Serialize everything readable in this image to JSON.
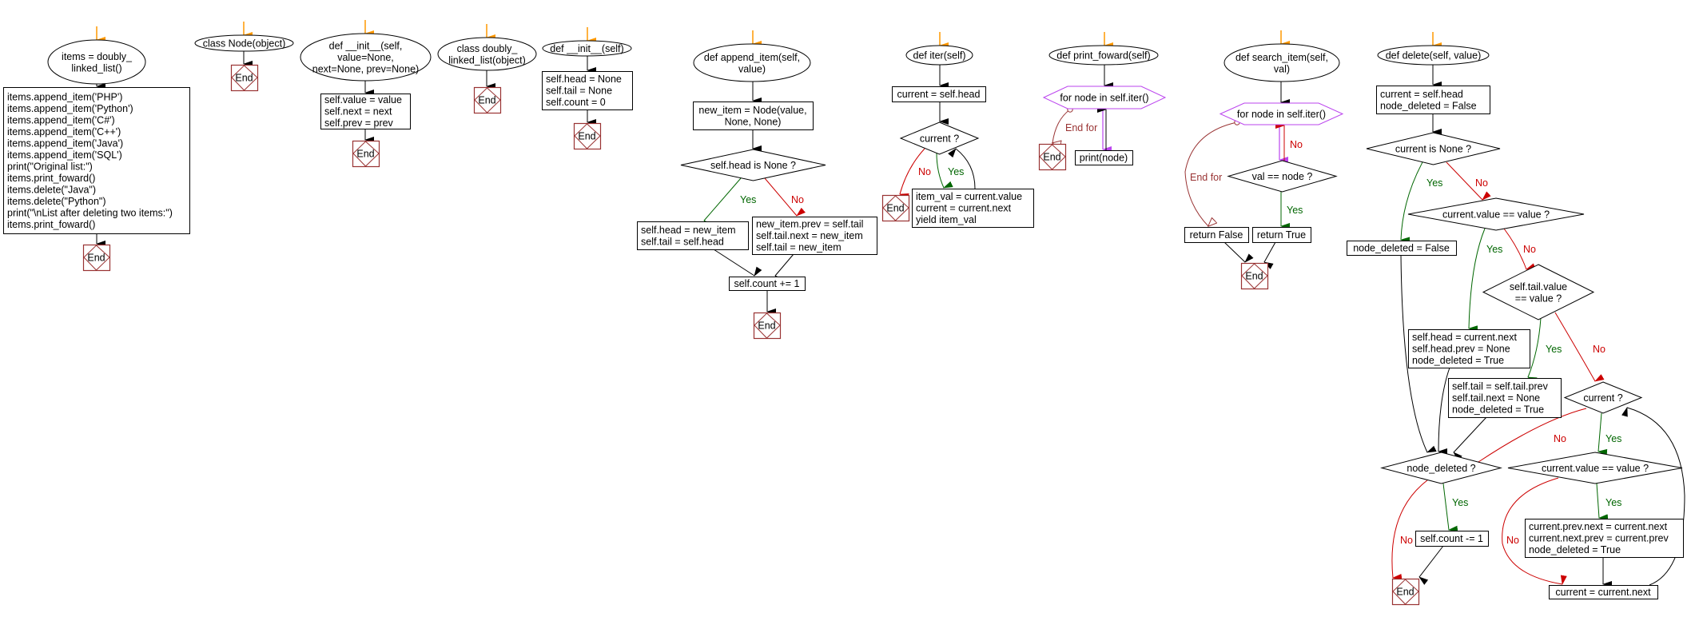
{
  "colors": {
    "start_arrow": "#ff9900",
    "yes": "#006600",
    "no": "#cc0000",
    "end_border": "#993333",
    "loop": "#bb44ee",
    "endfor": "#993333"
  },
  "labels": {
    "yes": "Yes",
    "no": "No",
    "end": "End",
    "end_for": "End for"
  },
  "charts": {
    "main": {
      "start": [
        "items = doubly_",
        "linked_list()"
      ],
      "body": [
        "items.append_item('PHP')",
        "items.append_item('Python')",
        "items.append_item('C#')",
        "items.append_item('C++')",
        "items.append_item('Java')",
        "items.append_item('SQL')",
        "print(\"Original list:\")",
        "items.print_foward()",
        "items.delete(\"Java\")",
        "items.delete(\"Python\")",
        "print(\"\\nList after deleting two items:\")",
        "items.print_foward()"
      ]
    },
    "node_class": {
      "start": [
        "class Node(object)"
      ]
    },
    "node_init": {
      "start": [
        "def __init__(self,",
        "value=None,",
        "next=None, prev=None)"
      ],
      "body": [
        "self.value = value",
        "self.next = next",
        "self.prev = prev"
      ]
    },
    "dll_class": {
      "start": [
        "class doubly_",
        "linked_list(object)"
      ]
    },
    "dll_init": {
      "start": [
        "def __init__(self)"
      ],
      "body": [
        "self.head = None",
        "self.tail = None",
        "self.count = 0"
      ]
    },
    "append_item": {
      "start": [
        "def append_item(self,",
        "value)"
      ],
      "step1": [
        "new_item = Node(value,",
        "None, None)"
      ],
      "cond": "self.head is None ?",
      "yes_body": [
        "self.head = new_item",
        "self.tail = self.head"
      ],
      "no_body": [
        "new_item.prev = self.tail",
        "self.tail.next = new_item",
        "self.tail = new_item"
      ],
      "step2": [
        "self.count += 1"
      ]
    },
    "iter": {
      "start": [
        "def iter(self)"
      ],
      "step1": [
        "current = self.head"
      ],
      "cond": "current ?",
      "yes_body": [
        "item_val = current.value",
        "current = current.next",
        "yield item_val"
      ]
    },
    "print_foward": {
      "start": [
        "def print_foward(self)"
      ],
      "loop": "for node in self.iter()",
      "body": [
        "print(node)"
      ]
    },
    "search_item": {
      "start": [
        "def search_item(self,",
        "val)"
      ],
      "loop": "for node in self.iter()",
      "cond": "val == node ?",
      "endfor_body": [
        "return False"
      ],
      "yes_body": [
        "return True"
      ]
    },
    "delete": {
      "start": [
        "def delete(self, value)"
      ],
      "step1": [
        "current = self.head",
        "node_deleted = False"
      ],
      "cond1": "current is None ?",
      "yes1": [
        "node_deleted = False"
      ],
      "cond2": "current.value == value ?",
      "yes2": [
        "self.head = current.next",
        "self.head.prev = None",
        "node_deleted = True"
      ],
      "cond3": [
        "self.tail.value",
        "== value ?"
      ],
      "yes3": [
        "self.tail = self.tail.prev",
        "self.tail.next = None",
        "node_deleted = True"
      ],
      "cond4": "current ?",
      "cond5": "current.value == value ?",
      "yes5": [
        "current.prev.next = current.next",
        "current.next.prev = current.prev",
        "node_deleted = True"
      ],
      "step_next": [
        "current = current.next"
      ],
      "cond6": "node_deleted ?",
      "yes6": [
        "self.count -= 1"
      ]
    }
  }
}
